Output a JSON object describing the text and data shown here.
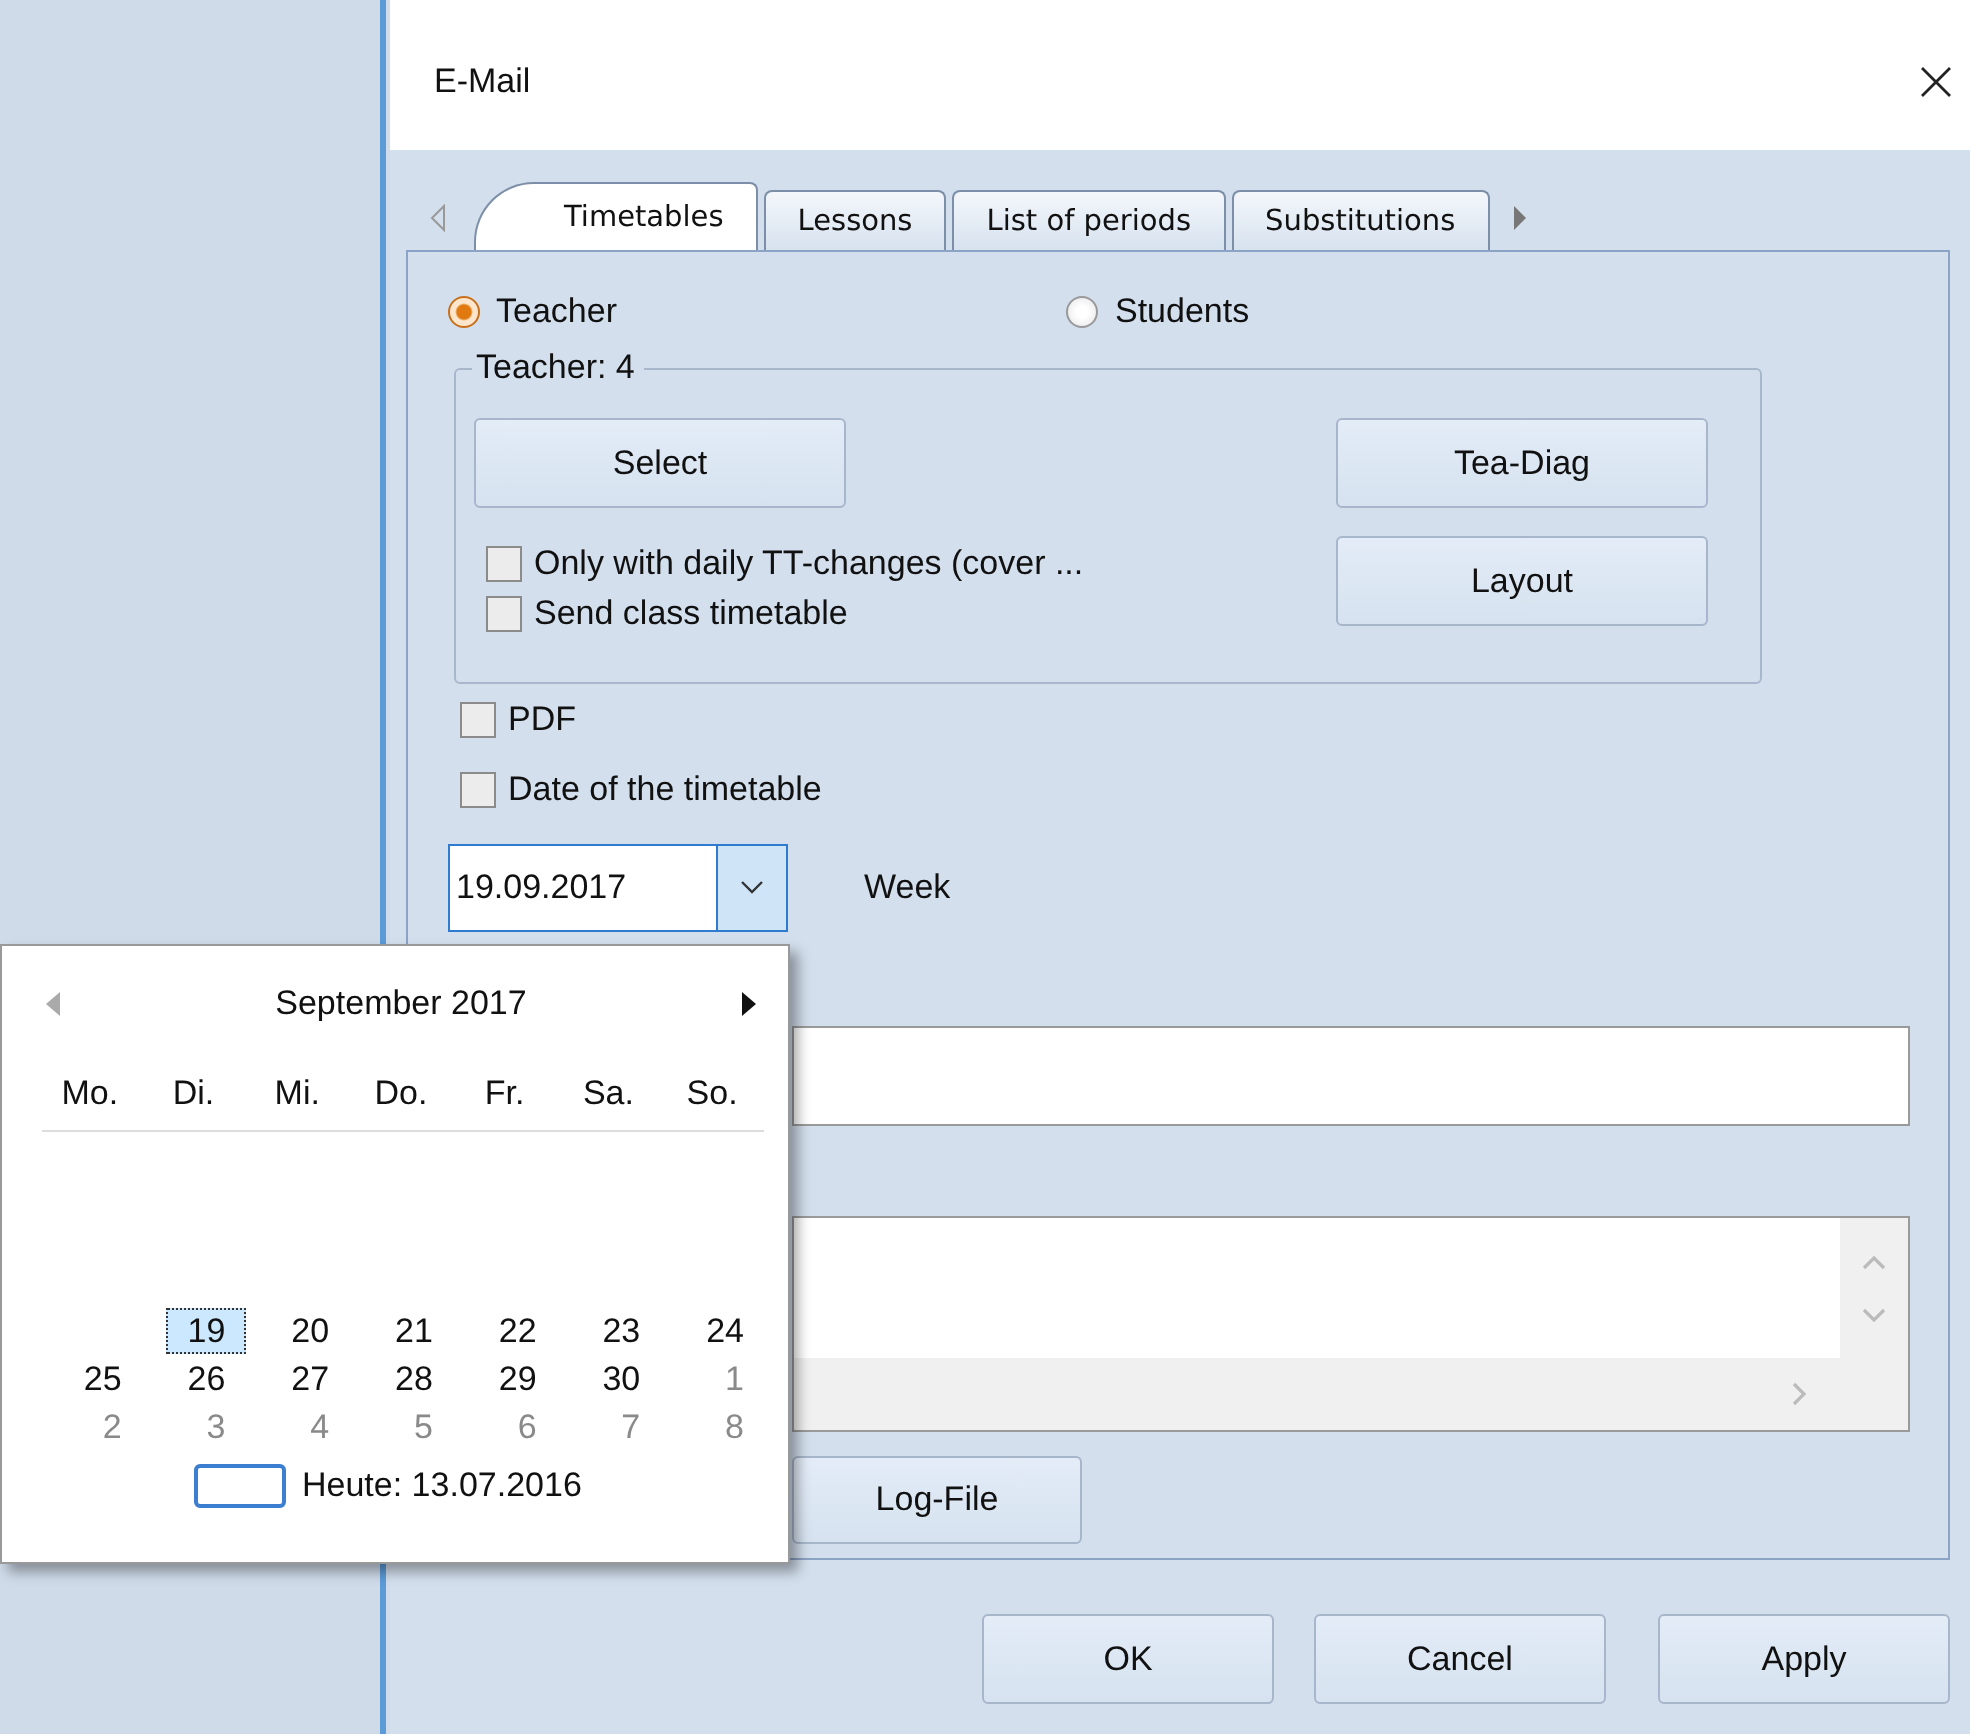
{
  "window": {
    "title": "E-Mail"
  },
  "tabs": [
    {
      "label": "Timetables",
      "selected": true
    },
    {
      "label": "Lessons",
      "selected": false
    },
    {
      "label": "List of periods",
      "selected": false
    },
    {
      "label": "Substitutions",
      "selected": false
    }
  ],
  "recipients": [
    {
      "label": "Teacher",
      "selected": true
    },
    {
      "label": "Students",
      "selected": false
    }
  ],
  "group": {
    "legend": "Teacher: 4",
    "select_button": "Select",
    "side_buttons": [
      "Tea-Diag",
      "Layout"
    ],
    "options": [
      {
        "label": "Only with daily TT-changes (cover ...",
        "checked": false
      },
      {
        "label": "Send class timetable",
        "checked": false
      }
    ]
  },
  "options": [
    {
      "label": "PDF",
      "checked": false
    },
    {
      "label": "Date of the timetable",
      "checked": false
    }
  ],
  "date": {
    "value": "19.09.2017",
    "week_label": "Week"
  },
  "calendar": {
    "month": "September 2017",
    "weekdays": [
      "Mo.",
      "Di.",
      "Mi.",
      "Do.",
      "Fr.",
      "Sa.",
      "So."
    ],
    "weeks": [
      [
        {
          "day": "19",
          "selected": true,
          "other_month": false
        },
        {
          "day": "20",
          "selected": false,
          "other_month": false
        },
        {
          "day": "21",
          "selected": false,
          "other_month": false
        },
        {
          "day": "22",
          "selected": false,
          "other_month": false
        },
        {
          "day": "23",
          "selected": false,
          "other_month": false
        },
        {
          "day": "24",
          "selected": false,
          "other_month": false
        }
      ],
      [
        {
          "day": "25",
          "selected": false,
          "other_month": false
        },
        {
          "day": "26",
          "selected": false,
          "other_month": false
        },
        {
          "day": "27",
          "selected": false,
          "other_month": false
        },
        {
          "day": "28",
          "selected": false,
          "other_month": false
        },
        {
          "day": "29",
          "selected": false,
          "other_month": false
        },
        {
          "day": "30",
          "selected": false,
          "other_month": false
        },
        {
          "day": "1",
          "selected": false,
          "other_month": true
        }
      ],
      [
        {
          "day": "2",
          "selected": false,
          "other_month": true
        },
        {
          "day": "3",
          "selected": false,
          "other_month": true
        },
        {
          "day": "4",
          "selected": false,
          "other_month": true
        },
        {
          "day": "5",
          "selected": false,
          "other_month": true
        },
        {
          "day": "6",
          "selected": false,
          "other_month": true
        },
        {
          "day": "7",
          "selected": false,
          "other_month": true
        },
        {
          "day": "8",
          "selected": false,
          "other_month": true
        }
      ]
    ],
    "today": "Heute: 13.07.2016"
  },
  "log_button": "Log-File",
  "buttons": [
    "OK",
    "Cancel",
    "Apply"
  ]
}
